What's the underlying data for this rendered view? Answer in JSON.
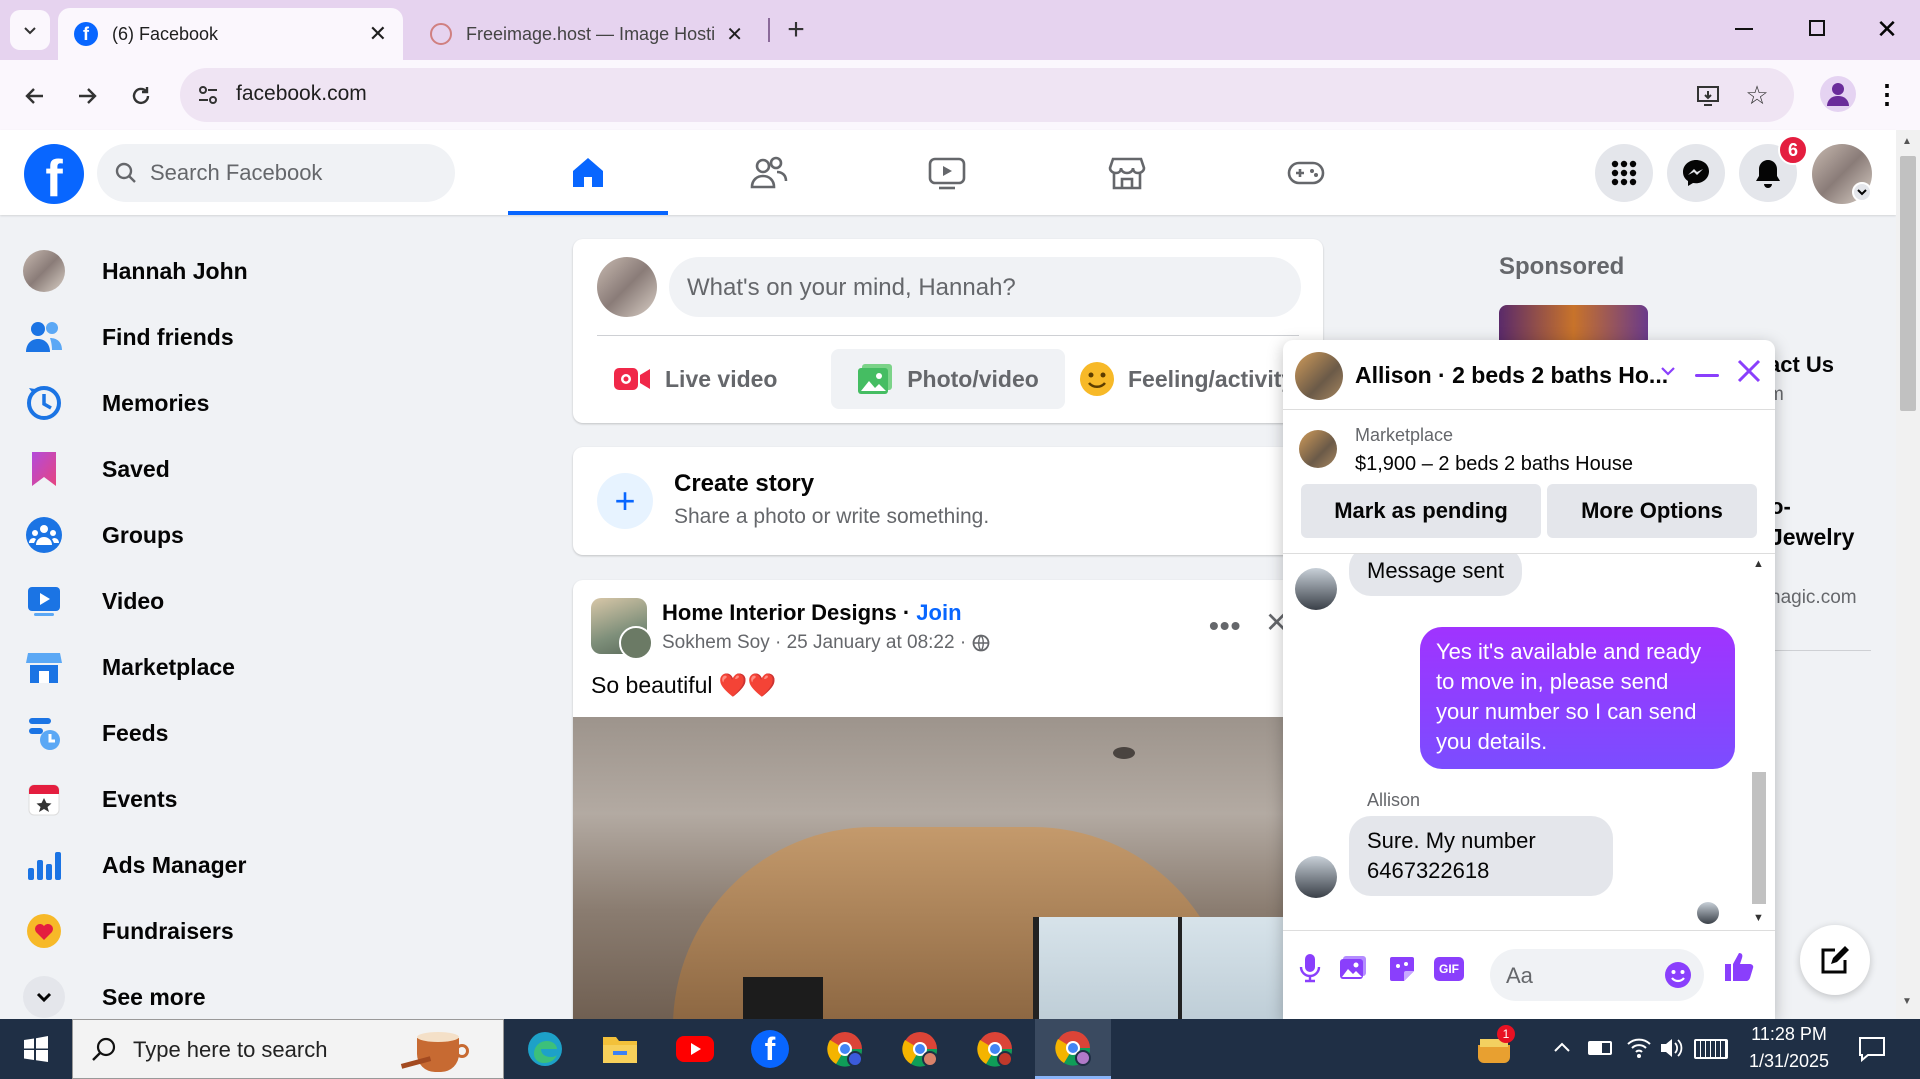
{
  "browser": {
    "tabs": [
      {
        "title": "(6) Facebook",
        "active": true
      },
      {
        "title": "Freeimage.host — Image Hosting",
        "active": false
      }
    ],
    "url": "facebook.com"
  },
  "header": {
    "search_placeholder": "Search Facebook",
    "notification_count": "6",
    "brand_color": "#0866ff"
  },
  "sidebar": {
    "items": [
      {
        "label": "Hannah John",
        "icon": "avatar"
      },
      {
        "label": "Find friends",
        "icon": "friends-icon"
      },
      {
        "label": "Memories",
        "icon": "memories-icon"
      },
      {
        "label": "Saved",
        "icon": "saved-icon"
      },
      {
        "label": "Groups",
        "icon": "groups-icon"
      },
      {
        "label": "Video",
        "icon": "video-icon"
      },
      {
        "label": "Marketplace",
        "icon": "marketplace-icon"
      },
      {
        "label": "Feeds",
        "icon": "feeds-icon"
      },
      {
        "label": "Events",
        "icon": "events-icon"
      },
      {
        "label": "Ads Manager",
        "icon": "ads-manager-icon"
      },
      {
        "label": "Fundraisers",
        "icon": "fundraisers-icon"
      },
      {
        "label": "See more",
        "icon": "chevron-down-icon"
      }
    ]
  },
  "composer": {
    "placeholder": "What's on your mind, Hannah?",
    "live_label": "Live video",
    "photo_label": "Photo/video",
    "feeling_label": "Feeling/activity"
  },
  "story": {
    "title": "Create story",
    "subtitle": "Share a photo or write something."
  },
  "post": {
    "group": "Home Interior Designs",
    "join": "Join",
    "author_line": "Sokhem Soy · 25 January at 08:22 ·",
    "text": "So beautiful ❤️❤️"
  },
  "right": {
    "sponsored": "Sponsored",
    "partial1": "act Us",
    "partial2": "m",
    "partial3": "o-",
    "partial4": "Jewelry",
    "partial5": "nagic.com"
  },
  "chat": {
    "title": "Allison · 2 beds 2 baths Ho...",
    "listing_source": "Marketplace",
    "listing_title": "$1,900 – 2 beds 2 baths House",
    "pending_btn": "Mark as pending",
    "options_btn": "More Options",
    "messages": [
      {
        "from": "them",
        "text": "Message sent"
      },
      {
        "from": "me",
        "text": "Yes it's available and ready to move in, please send your number so I can send you details."
      },
      {
        "from": "them",
        "sender": "Allison",
        "text": "Sure. My number 6467322618"
      }
    ],
    "input_placeholder": "Aa",
    "accent": "#8a3ffc"
  },
  "taskbar": {
    "search_placeholder": "Type here to search",
    "time": "11:28 PM",
    "date": "1/31/2025",
    "tray_badge": "1"
  }
}
